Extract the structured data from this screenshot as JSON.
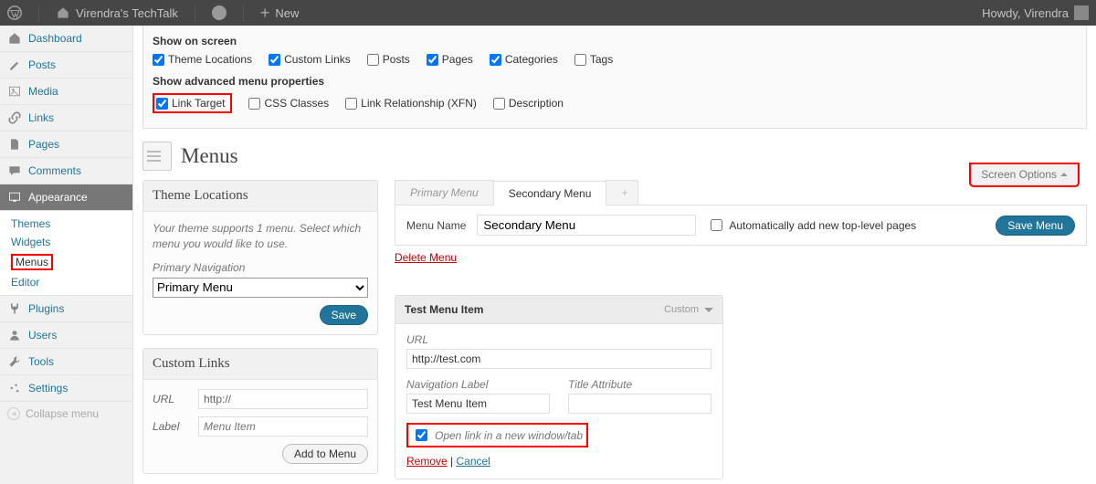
{
  "adminbar": {
    "site_title": "Virendra's TechTalk",
    "new_label": "New",
    "howdy": "Howdy, Virendra"
  },
  "sidebar": {
    "items": [
      {
        "label": "Dashboard"
      },
      {
        "label": "Posts"
      },
      {
        "label": "Media"
      },
      {
        "label": "Links"
      },
      {
        "label": "Pages"
      },
      {
        "label": "Comments"
      },
      {
        "label": "Appearance"
      },
      {
        "label": "Plugins"
      },
      {
        "label": "Users"
      },
      {
        "label": "Tools"
      },
      {
        "label": "Settings"
      }
    ],
    "appearance_sub": [
      "Themes",
      "Widgets",
      "Menus",
      "Editor"
    ],
    "collapse": "Collapse menu"
  },
  "screen_options": {
    "show_on_screen": "Show on screen",
    "opts1": [
      {
        "label": "Theme Locations",
        "checked": true
      },
      {
        "label": "Custom Links",
        "checked": true
      },
      {
        "label": "Posts",
        "checked": false
      },
      {
        "label": "Pages",
        "checked": true
      },
      {
        "label": "Categories",
        "checked": true
      },
      {
        "label": "Tags",
        "checked": false
      }
    ],
    "adv_title": "Show advanced menu properties",
    "opts2": [
      {
        "label": "Link Target",
        "checked": true,
        "hi": true
      },
      {
        "label": "CSS Classes",
        "checked": false
      },
      {
        "label": "Link Relationship (XFN)",
        "checked": false
      },
      {
        "label": "Description",
        "checked": false
      }
    ],
    "tab_label": "Screen Options"
  },
  "page": {
    "title": "Menus"
  },
  "theme_locations": {
    "title": "Theme Locations",
    "desc": "Your theme supports 1 menu. Select which menu you would like to use.",
    "field_label": "Primary Navigation",
    "value": "Primary Menu",
    "save": "Save"
  },
  "custom_links": {
    "title": "Custom Links",
    "url_label": "URL",
    "url_value": "http://",
    "label_label": "Label",
    "label_placeholder": "Menu Item",
    "add": "Add to Menu"
  },
  "tabs": {
    "primary": "Primary Menu",
    "secondary": "Secondary Menu",
    "add": "+"
  },
  "menu_settings": {
    "name_label": "Menu Name",
    "name_value": "Secondary Menu",
    "auto_add": "Automatically add new top-level pages",
    "delete": "Delete Menu",
    "save": "Save Menu"
  },
  "menu_item": {
    "title": "Test Menu Item",
    "type": "Custom",
    "url_label": "URL",
    "url_value": "http://test.com",
    "nav_label_label": "Navigation Label",
    "nav_label_value": "Test Menu Item",
    "title_attr_label": "Title Attribute",
    "title_attr_value": "",
    "link_target_label": "Open link in a new window/tab",
    "link_target_checked": true,
    "remove": "Remove",
    "cancel": "Cancel"
  }
}
